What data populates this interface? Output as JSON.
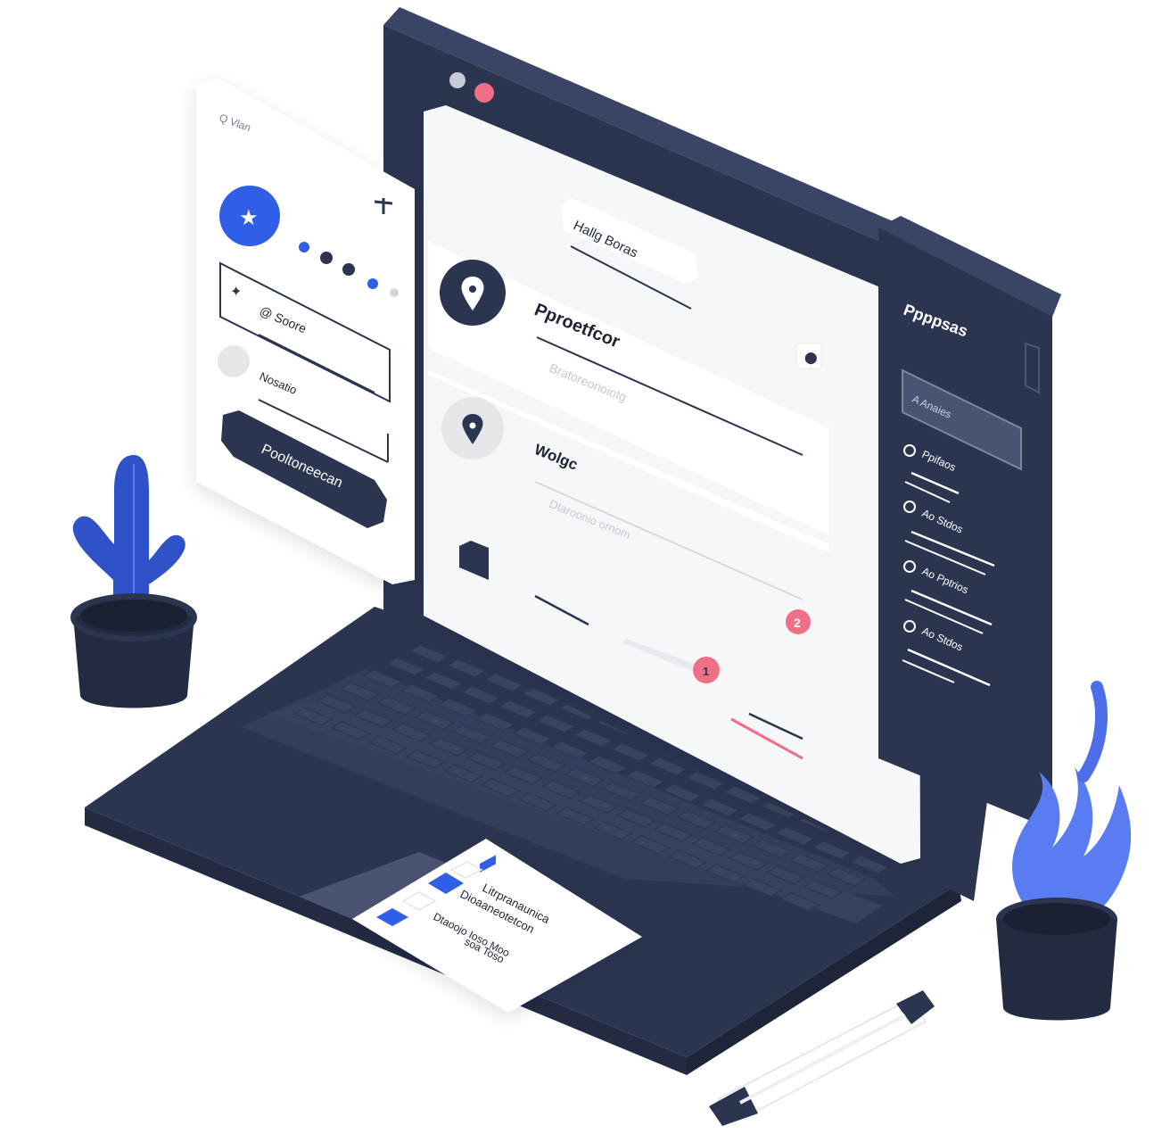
{
  "colors": {
    "navy": "#2b3550",
    "navy_dark": "#222b42",
    "blue": "#2f5fe6",
    "blue_light": "#5a7cf2",
    "pink": "#ef6f86",
    "panel": "#f6f7f9",
    "white": "#ffffff"
  },
  "left_card": {
    "search_text": "Q  Vlan",
    "field1_label": "@ Soore",
    "field2_label": "Nosatio",
    "button_label": "Pooltoneecan",
    "avatar_icon": "star-icon"
  },
  "main_panel": {
    "header_title": "Hallg Boras",
    "item1_title": "Pproetfcor",
    "item1_sub": "Bratoreonoiotg",
    "item2_title": "Wolgc",
    "item2_sub": "Dtaroonio  ornom",
    "badge1": "2",
    "badge2": "1"
  },
  "right_sidebar": {
    "title": "Ppppsas",
    "search_label": "A  Anaies",
    "items": [
      {
        "icon": "circle-icon",
        "label": "Ppifaos"
      },
      {
        "icon": "globe-icon",
        "label": "Ao Stdos"
      },
      {
        "icon": "clock-icon",
        "label": "Ao Pptrios"
      },
      {
        "icon": "info-icon",
        "label": "Ao Stdos"
      }
    ]
  },
  "note_card": {
    "lines": [
      "Litrpranaunica",
      "Dioaaneotetcon",
      "Dtaoojo  Ioso  Moo",
      "soa  Toso"
    ]
  }
}
